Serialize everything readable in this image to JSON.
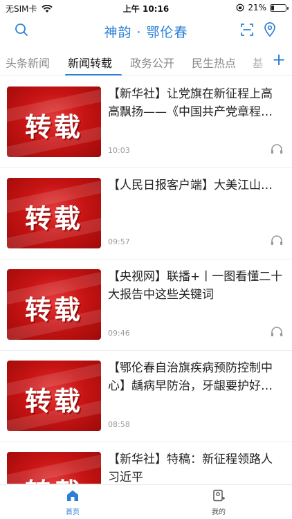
{
  "status_bar": {
    "carrier": "无SIM卡",
    "time": "上午 10:16",
    "battery_text": "21%",
    "battery_level": 0.21
  },
  "header": {
    "title": "神韵 · 鄂伦春",
    "search_icon": "search-icon",
    "scan_icon": "scan-icon",
    "location_icon": "location-pin-icon",
    "accent_color": "#2b7fd6"
  },
  "tabs": [
    {
      "label": "头条新闻",
      "active": false
    },
    {
      "label": "新闻转载",
      "active": true
    },
    {
      "label": "政务公开",
      "active": false
    },
    {
      "label": "民生热点",
      "active": false
    },
    {
      "label": "基",
      "active": false
    }
  ],
  "tab_add_label": "+",
  "news": [
    {
      "thumb_text": "转载",
      "headline": "【新华社】让党旗在新征程上高高飘扬——《中国共产党章程…",
      "time": "10:03"
    },
    {
      "thumb_text": "转载",
      "headline": "【人民日报客户端】大美江山…",
      "time": "09:57"
    },
    {
      "thumb_text": "转载",
      "headline": "【央视网】联播+丨一图看懂二十大报告中这些关键词",
      "time": "09:46"
    },
    {
      "thumb_text": "转载",
      "headline": "【鄂伦春自治旗疾病预防控制中心】龋病早防治，牙龈要护好…",
      "time": "08:58"
    },
    {
      "thumb_text": "转载",
      "headline": "【新华社】特稿：新征程领路人习近平",
      "time": ""
    }
  ],
  "bottom_nav": {
    "home_label": "首页",
    "mine_label": "我的"
  }
}
